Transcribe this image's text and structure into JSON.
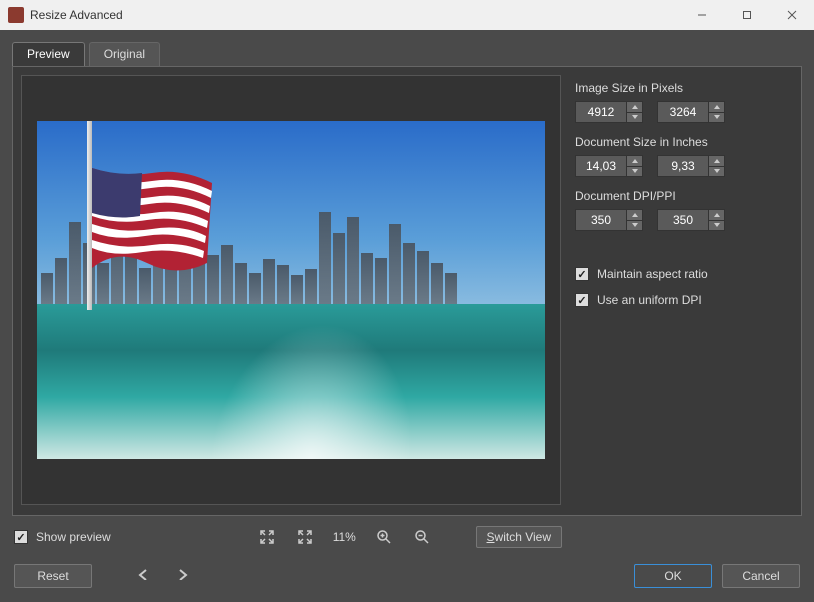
{
  "window": {
    "title": "Resize Advanced"
  },
  "tabs": {
    "preview": "Preview",
    "original": "Original",
    "active": "preview"
  },
  "controls": {
    "pixels_label": "Image Size in Pixels",
    "width_px": "4912",
    "height_px": "3264",
    "inches_label": "Document Size in Inches",
    "width_in": "14,03",
    "height_in": "9,33",
    "dpi_label": "Document DPI/PPI",
    "dpi_x": "350",
    "dpi_y": "350",
    "maintain_aspect": "Maintain aspect ratio",
    "uniform_dpi": "Use an uniform DPI",
    "maintain_aspect_checked": true,
    "uniform_dpi_checked": true
  },
  "toolbar": {
    "show_preview": "Show preview",
    "show_preview_checked": true,
    "zoom_pct": "11%",
    "switch_view": "Switch View",
    "switch_view_key": "S"
  },
  "footer": {
    "reset": "Reset",
    "ok": "OK",
    "cancel": "Cancel"
  }
}
